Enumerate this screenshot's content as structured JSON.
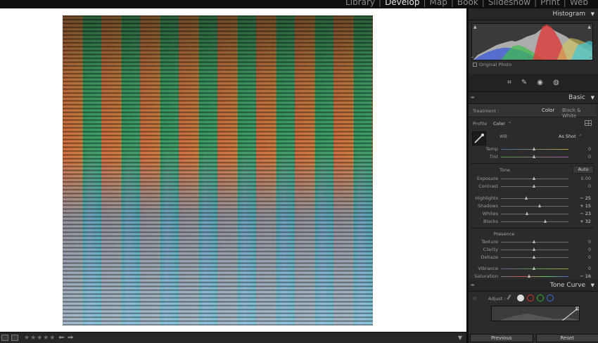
{
  "modules": [
    "Library",
    "Develop",
    "Map",
    "Book",
    "Slideshow",
    "Print",
    "Web"
  ],
  "active_module": "Develop",
  "histogram": {
    "title": "Histogram",
    "original_photo_label": "Original Photo"
  },
  "basic": {
    "title": "Basic",
    "treatment_label": "Treatment :",
    "treatment_color": "Color",
    "treatment_bw": "Black & White",
    "profile_label": "Profile",
    "profile_value": "Color",
    "wb_label": "WB",
    "wb_value": "As Shot",
    "tone_label": "Tone",
    "auto_label": "Auto",
    "presence_label": "Presence",
    "sliders": [
      {
        "label": "Temp",
        "value": "0",
        "pos": 0.5
      },
      {
        "label": "Tint",
        "value": "0",
        "pos": 0.5
      },
      {
        "label": "Exposure",
        "value": "0.00",
        "pos": 0.5
      },
      {
        "label": "Contrast",
        "value": "0",
        "pos": 0.5
      },
      {
        "label": "Highlights",
        "value": "− 25",
        "pos": 0.375
      },
      {
        "label": "Shadows",
        "value": "+ 15",
        "pos": 0.575
      },
      {
        "label": "Whites",
        "value": "− 23",
        "pos": 0.385
      },
      {
        "label": "Blacks",
        "value": "+ 32",
        "pos": 0.66
      },
      {
        "label": "Texture",
        "value": "0",
        "pos": 0.5
      },
      {
        "label": "Clarity",
        "value": "0",
        "pos": 0.5
      },
      {
        "label": "Dehaze",
        "value": "0",
        "pos": 0.5
      },
      {
        "label": "Vibrance",
        "value": "0",
        "pos": 0.5
      },
      {
        "label": "Saturation",
        "value": "− 16",
        "pos": 0.42
      }
    ]
  },
  "tone_curve": {
    "title": "Tone Curve",
    "adjust_label": "Adjust :"
  },
  "buttons": {
    "previous": "Previous",
    "reset": "Reset"
  },
  "colors": {
    "panel_bg": "#2b2b2b",
    "canvas_bg": "#ffffff",
    "accent_red": "#e0302a",
    "accent_green": "#2fb43a",
    "accent_blue": "#3a6fe0"
  }
}
